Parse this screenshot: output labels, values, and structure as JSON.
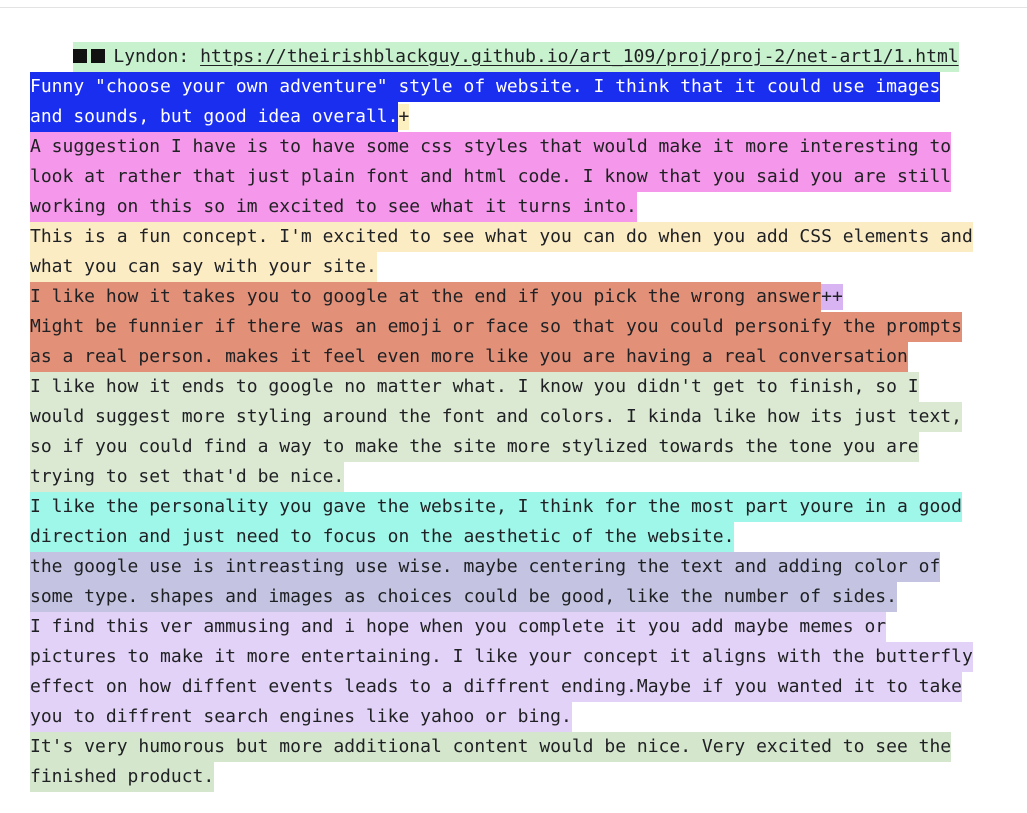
{
  "header": {
    "author": "Lyndon:",
    "url": "https://theirishblackguy.github.io/art_109/proj/proj-2/net-art1/1.html",
    "highlight": "#c8f2cd"
  },
  "comments": [
    {
      "color": "#1a2ef0",
      "text_color": "#ffffff",
      "lines": [
        "Funny \"choose your own adventure\" style of website. I think that it could use images",
        "and sounds, but good idea overall."
      ],
      "tail": "+",
      "tail_color": "#fdf0c0"
    },
    {
      "color": "#f597ea",
      "lines": [
        "A suggestion I have is to have some css styles that would make it more interesting to",
        "look at rather that just plain font and html code. I know that you said you are still",
        "working on this so im excited to see what it turns into."
      ]
    },
    {
      "color": "#fcecc3",
      "lines": [
        "This is a fun concept. I'm excited to see what you can do when you add CSS elements and",
        "what you can say with your site."
      ]
    },
    {
      "color": "#e29178",
      "lines": [
        "I like how it takes you to google at the end if you pick the wrong answer"
      ],
      "tail": "++",
      "tail_color": "#d8b4f2"
    },
    {
      "color": "#e29178",
      "lines": [
        "Might be funnier if there was an emoji or face so that you could personify the prompts",
        "as a real person. makes it feel even more like you are having a real conversation"
      ]
    },
    {
      "color": "#dbe9d2",
      "lines": [
        "I like how it ends to google no matter what. I know you didn't get to finish, so I",
        "would suggest more styling around the font and colors. I kinda like how its just text,",
        "so if you could find a way to make the site more stylized towards the tone you are",
        "trying to set that'd be nice."
      ]
    },
    {
      "color": "#9ff7ea",
      "lines": [
        "I like the personality you gave the website, I think for the most part youre in a good",
        "direction and just need to focus on the aesthetic of the website."
      ]
    },
    {
      "color": "#c4c4e2",
      "lines": [
        "the google use is intreasting use wise. maybe centering the text and adding color of",
        "some type. shapes and images as choices could be good, like the number of sides."
      ]
    },
    {
      "color": "#e2d2f7",
      "lines": [
        "I find this ver ammusing and i hope when you complete it you add maybe memes or",
        "pictures to make it more entertaining. I like your concept it aligns with the butterfly",
        "effect on how diffent events leads to a diffrent ending.Maybe if you wanted it to take",
        "you to diffrent search engines like yahoo or bing."
      ]
    },
    {
      "color": "#d4e6cc",
      "lines": [
        "It's very humorous but more additional content would be nice. Very excited to see the",
        "finished product."
      ]
    }
  ],
  "underline_colors": {
    "spelling": "#f28b82",
    "grammar": "#f6c94e"
  }
}
